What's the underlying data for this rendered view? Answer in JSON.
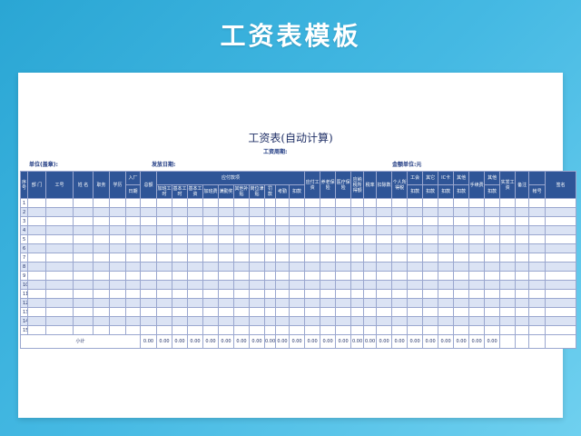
{
  "banner": {
    "title": "工资表模板"
  },
  "sheet": {
    "title": "工资表(自动计算)",
    "period_label": "工资周期:",
    "unit_label": "单位(盖章):",
    "issue_date_label": "发放日期:",
    "currency_label": "金额单位:元"
  },
  "headers": {
    "seq": "序号",
    "dept": "部 门",
    "emp_no": "工号",
    "name": "姓 名",
    "position": "职务",
    "education": "学历",
    "hire_top": "入厂",
    "hire_bottom": "日期",
    "total": "总额",
    "payable_group": "应付款项",
    "overtime_hours": "加班工时",
    "basic_hours": "基本工时",
    "basic_wage": "基本工资",
    "overtime_pay": "加班费",
    "diligence": "满勤奖",
    "other_subsidy": "其他补贴",
    "post_allowance": "岗位津贴",
    "fine_top": "罚",
    "fine_bottom": "款",
    "attendance_top": "考勤",
    "attendance_bottom": "扣款",
    "payable_wage": "应付工资",
    "pension": "养老保险",
    "medical": "医疗保险",
    "taxable": "应纳税所得额",
    "tax_rate": "税率",
    "deduction_num": "扣除数",
    "income_tax": "个人所得税",
    "union_top": "工会",
    "union_bottom": "扣款",
    "other1_top": "其它",
    "other1_bottom": "扣款",
    "ic_top": "IC卡",
    "ic_bottom": "扣款",
    "other2_top": "其他",
    "other2_bottom": "扣款",
    "handling_fee": "手续费",
    "other3_top": "其他",
    "other3_bottom": "扣款",
    "net_pay": "实发工资",
    "remark": "备注",
    "account": "帐号",
    "signature": "签名"
  },
  "rows": [
    "1",
    "2",
    "3",
    "4",
    "5",
    "6",
    "7",
    "8",
    "9",
    "10",
    "11",
    "12",
    "13",
    "14",
    "15"
  ],
  "footer": {
    "subtotal_label": "小计",
    "totals": [
      "0.00",
      "0.00",
      "0.00",
      "0.00",
      "0.00",
      "0.00",
      "0.00",
      "0.00",
      "0.00",
      "0.00",
      "0.00",
      "0.00",
      "0.00",
      "0.00",
      "0.00",
      "0.00",
      "0.00",
      "0.00",
      "0.00",
      "0.00",
      "0.00",
      "0.00",
      "0.00",
      "0.00"
    ]
  }
}
